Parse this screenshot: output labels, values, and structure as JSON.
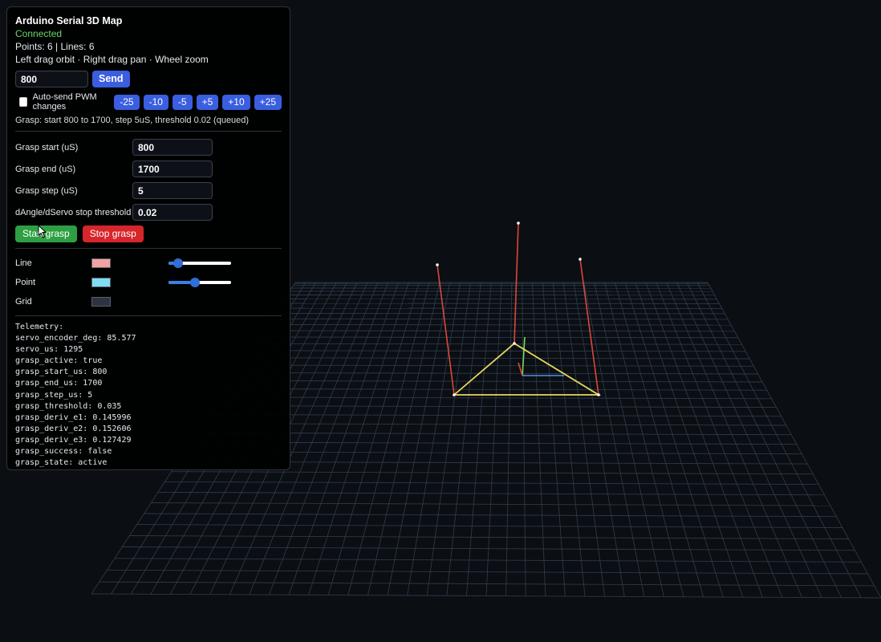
{
  "panel": {
    "title": "Arduino Serial 3D Map",
    "status": "Connected",
    "counts": "Points: 6 | Lines: 6",
    "controls_hint": "Left drag orbit · Right drag pan · Wheel zoom",
    "pwm_value": "800",
    "send_label": "Send",
    "auto_send_label": "Auto-send PWM changes",
    "auto_send_checked": false,
    "step_buttons": [
      "-25",
      "-10",
      "-5",
      "+5",
      "+10",
      "+25"
    ],
    "grasp_note": "Grasp: start 800 to 1700, step 5uS, threshold 0.02 (queued)",
    "fields": [
      {
        "label": "Grasp start (uS)",
        "value": "800"
      },
      {
        "label": "Grasp end (uS)",
        "value": "1700"
      },
      {
        "label": "Grasp step (uS)",
        "value": "5"
      },
      {
        "label": "dAngle/dServo stop threshold",
        "value": "0.02"
      }
    ],
    "start_grasp_label": "Start grasp",
    "stop_grasp_label": "Stop grasp",
    "style": [
      {
        "label": "Line",
        "color": "#f4a3a3",
        "slider_fraction": 0.15
      },
      {
        "label": "Point",
        "color": "#7fdcf3",
        "slider_fraction": 0.42
      },
      {
        "label": "Grid",
        "color": "#2b3440"
      }
    ],
    "telemetry_title": "Telemetry:",
    "telemetry": [
      "servo_encoder_deg: 85.577",
      "servo_us: 1295",
      "grasp_active: true",
      "grasp_start_us: 800",
      "grasp_end_us: 1700",
      "grasp_step_us: 5",
      "grasp_threshold: 0.035",
      "grasp_deriv_e1: 0.145996",
      "grasp_deriv_e2: 0.152606",
      "grasp_deriv_e3: 0.127429",
      "grasp_success: false",
      "grasp_state: active"
    ]
  },
  "scene": {
    "background": "#0b0e13",
    "grid_color": "#2b3a4a",
    "line_color": "#d9483b",
    "triangle_color": "#e7d85b",
    "axis_x_color": "#5b8ee8",
    "axis_y_color": "#7cd45c",
    "point_color": "#ffffff"
  }
}
